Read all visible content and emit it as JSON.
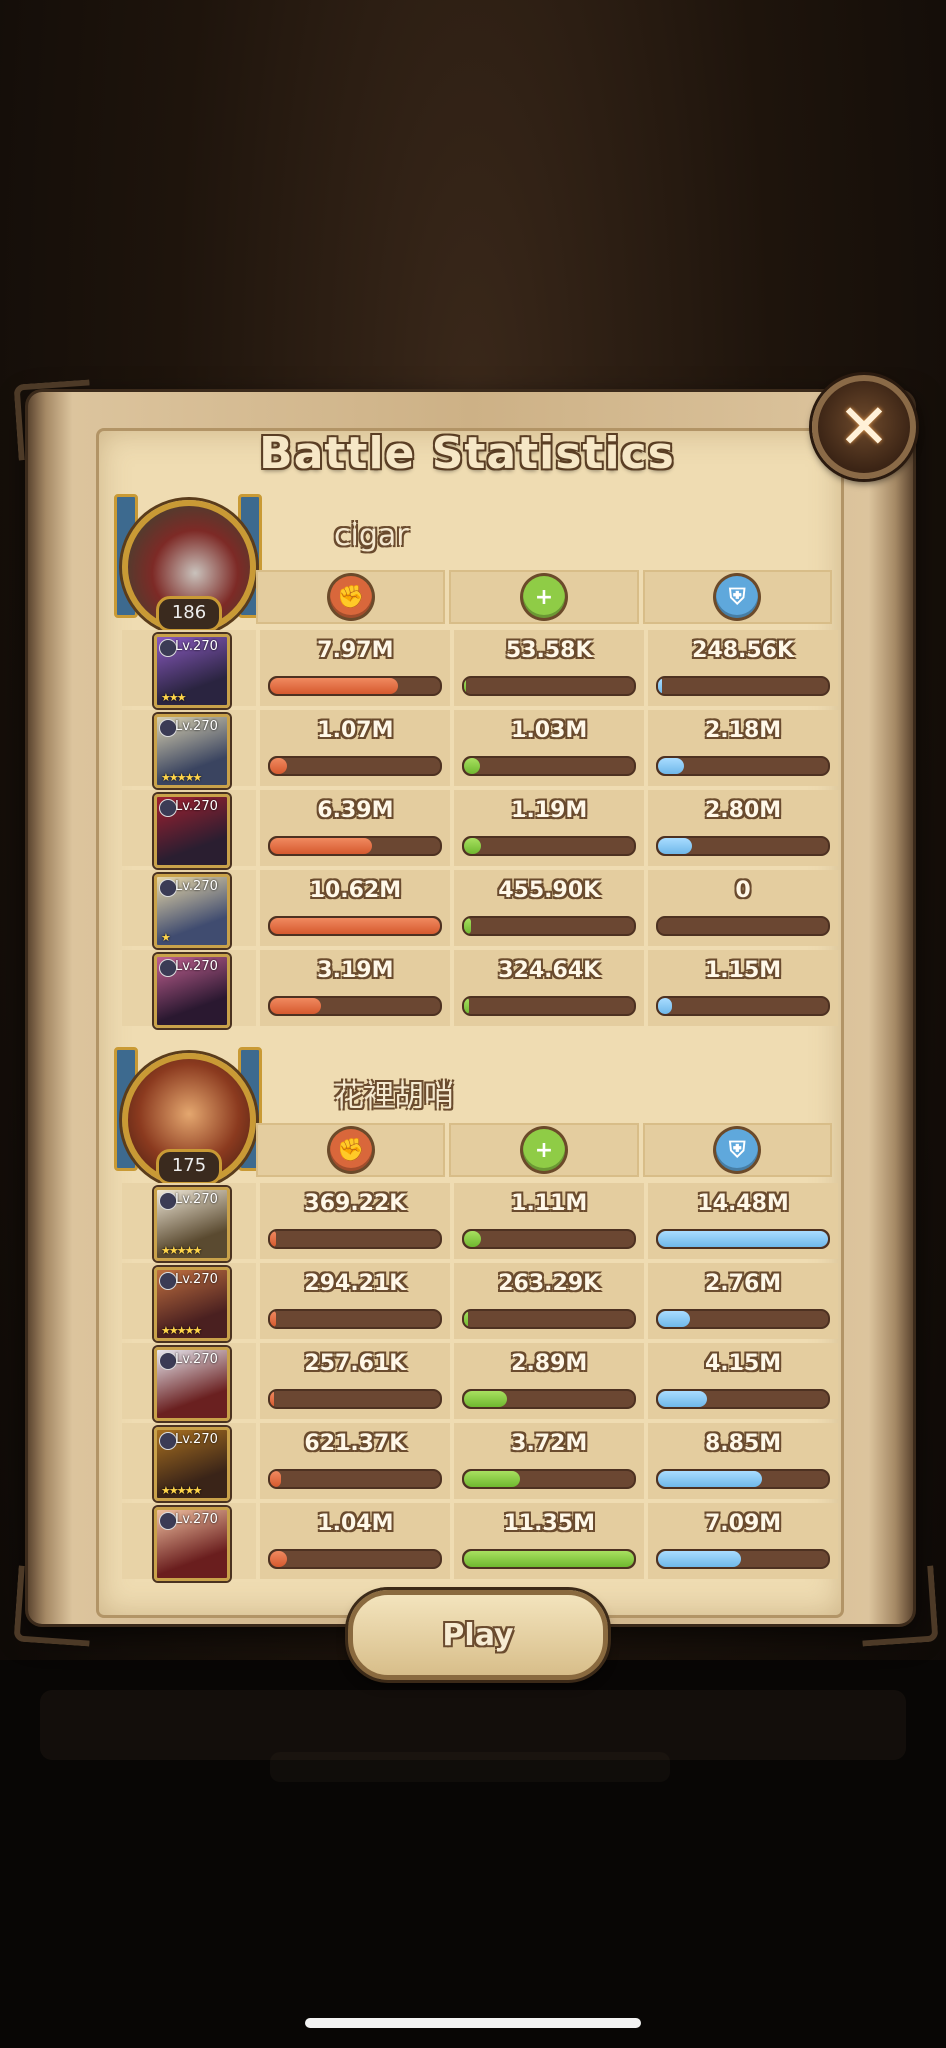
{
  "title": "Battle Statistics",
  "close_label": "✕",
  "play_label": "Play",
  "colors": {
    "damage": "#d9673b",
    "heal": "#8fcc46",
    "defense": "#5fa8dc"
  },
  "stat_icons": [
    "damage-icon",
    "heal-icon",
    "shield-icon"
  ],
  "teams": [
    {
      "name": "cigar",
      "level": "186",
      "heroes": [
        {
          "level": "Lv.270",
          "stars": "★★★",
          "damage": "7.97M",
          "heal": "53.58K",
          "defense": "248.56K",
          "damage_pct": 75,
          "heal_pct": 1,
          "defense_pct": 2
        },
        {
          "level": "Lv.270",
          "stars": "★★★★★",
          "damage": "1.07M",
          "heal": "1.03M",
          "defense": "2.18M",
          "damage_pct": 10,
          "heal_pct": 9,
          "defense_pct": 15
        },
        {
          "level": "Lv.270",
          "stars": "",
          "damage": "6.39M",
          "heal": "1.19M",
          "defense": "2.80M",
          "damage_pct": 60,
          "heal_pct": 10,
          "defense_pct": 20
        },
        {
          "level": "Lv.270",
          "stars": "★",
          "damage": "10.62M",
          "heal": "455.90K",
          "defense": "0",
          "damage_pct": 100,
          "heal_pct": 4,
          "defense_pct": 0
        },
        {
          "level": "Lv.270",
          "stars": "",
          "damage": "3.19M",
          "heal": "324.64K",
          "defense": "1.15M",
          "damage_pct": 30,
          "heal_pct": 3,
          "defense_pct": 8
        }
      ]
    },
    {
      "name": "花裡胡哨",
      "level": "175",
      "heroes": [
        {
          "level": "Lv.270",
          "stars": "★★★★★",
          "damage": "369.22K",
          "heal": "1.11M",
          "defense": "14.48M",
          "damage_pct": 3,
          "heal_pct": 10,
          "defense_pct": 100
        },
        {
          "level": "Lv.270",
          "stars": "★★★★★",
          "damage": "294.21K",
          "heal": "263.29K",
          "defense": "2.76M",
          "damage_pct": 3,
          "heal_pct": 2,
          "defense_pct": 19
        },
        {
          "level": "Lv.270",
          "stars": "",
          "damage": "257.61K",
          "heal": "2.89M",
          "defense": "4.15M",
          "damage_pct": 2,
          "heal_pct": 25,
          "defense_pct": 29
        },
        {
          "level": "Lv.270",
          "stars": "★★★★★",
          "damage": "621.37K",
          "heal": "3.72M",
          "defense": "8.85M",
          "damage_pct": 6,
          "heal_pct": 33,
          "defense_pct": 61
        },
        {
          "level": "Lv.270",
          "stars": "",
          "damage": "1.04M",
          "heal": "11.35M",
          "defense": "7.09M",
          "damage_pct": 10,
          "heal_pct": 100,
          "defense_pct": 49
        }
      ]
    }
  ]
}
